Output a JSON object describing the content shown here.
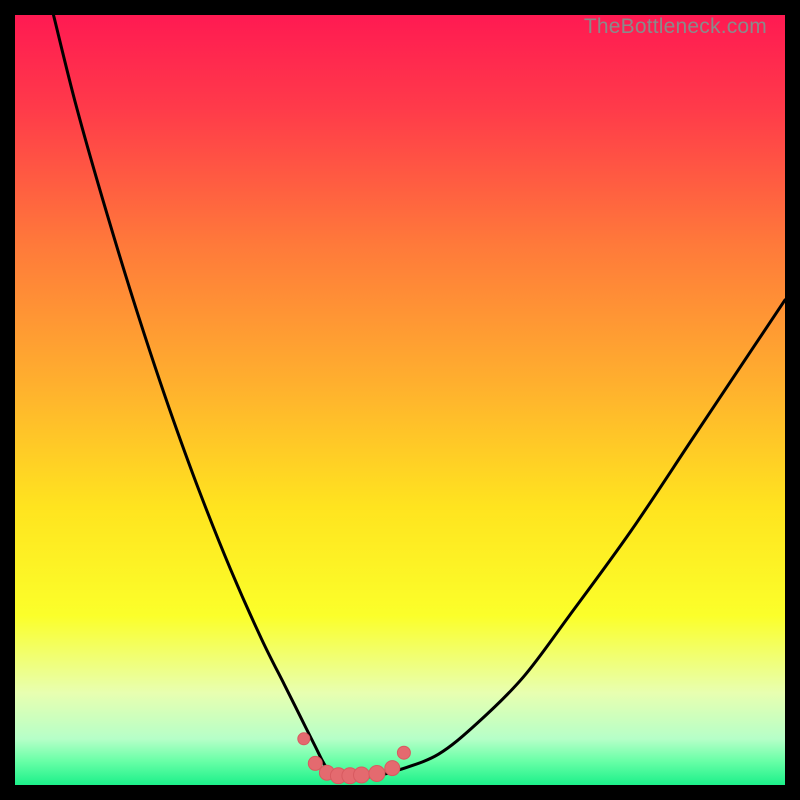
{
  "watermark": "TheBottleneck.com",
  "colors": {
    "gradient_stops": [
      {
        "offset": 0.0,
        "color": "#ff1a52"
      },
      {
        "offset": 0.12,
        "color": "#ff3a4a"
      },
      {
        "offset": 0.3,
        "color": "#ff7a3a"
      },
      {
        "offset": 0.48,
        "color": "#ffb02e"
      },
      {
        "offset": 0.64,
        "color": "#ffe41f"
      },
      {
        "offset": 0.78,
        "color": "#fbff2a"
      },
      {
        "offset": 0.88,
        "color": "#e8ffb0"
      },
      {
        "offset": 0.94,
        "color": "#b6ffc8"
      },
      {
        "offset": 0.97,
        "color": "#66ffa6"
      },
      {
        "offset": 1.0,
        "color": "#1cf08a"
      }
    ],
    "curve": "#000000",
    "marker_fill": "#e46a6f",
    "marker_stroke": "#d85a60"
  },
  "chart_data": {
    "type": "line",
    "title": "",
    "xlabel": "",
    "ylabel": "",
    "xlim": [
      0,
      100
    ],
    "ylim": [
      0,
      100
    ],
    "grid": false,
    "series": [
      {
        "name": "bottleneck-curve",
        "x": [
          5,
          8,
          12,
          16,
          20,
          24,
          28,
          32,
          35,
          37,
          39,
          40,
          41,
          42,
          43,
          45,
          47,
          50,
          55,
          60,
          66,
          72,
          80,
          88,
          96,
          100
        ],
        "values": [
          100,
          88,
          74,
          61,
          49,
          38,
          28,
          19,
          13,
          9,
          5,
          3,
          1.5,
          1,
          1,
          1,
          1.2,
          2,
          4,
          8,
          14,
          22,
          33,
          45,
          57,
          63
        ]
      }
    ],
    "markers": {
      "name": "valley-markers",
      "x": [
        37.5,
        39.0,
        40.5,
        42.0,
        43.5,
        45.0,
        47.0,
        49.0,
        50.5
      ],
      "y": [
        6.0,
        2.8,
        1.6,
        1.2,
        1.2,
        1.3,
        1.5,
        2.2,
        4.2
      ],
      "r": [
        6,
        7,
        7.5,
        8,
        8,
        8,
        8,
        7.5,
        6.5
      ]
    }
  }
}
